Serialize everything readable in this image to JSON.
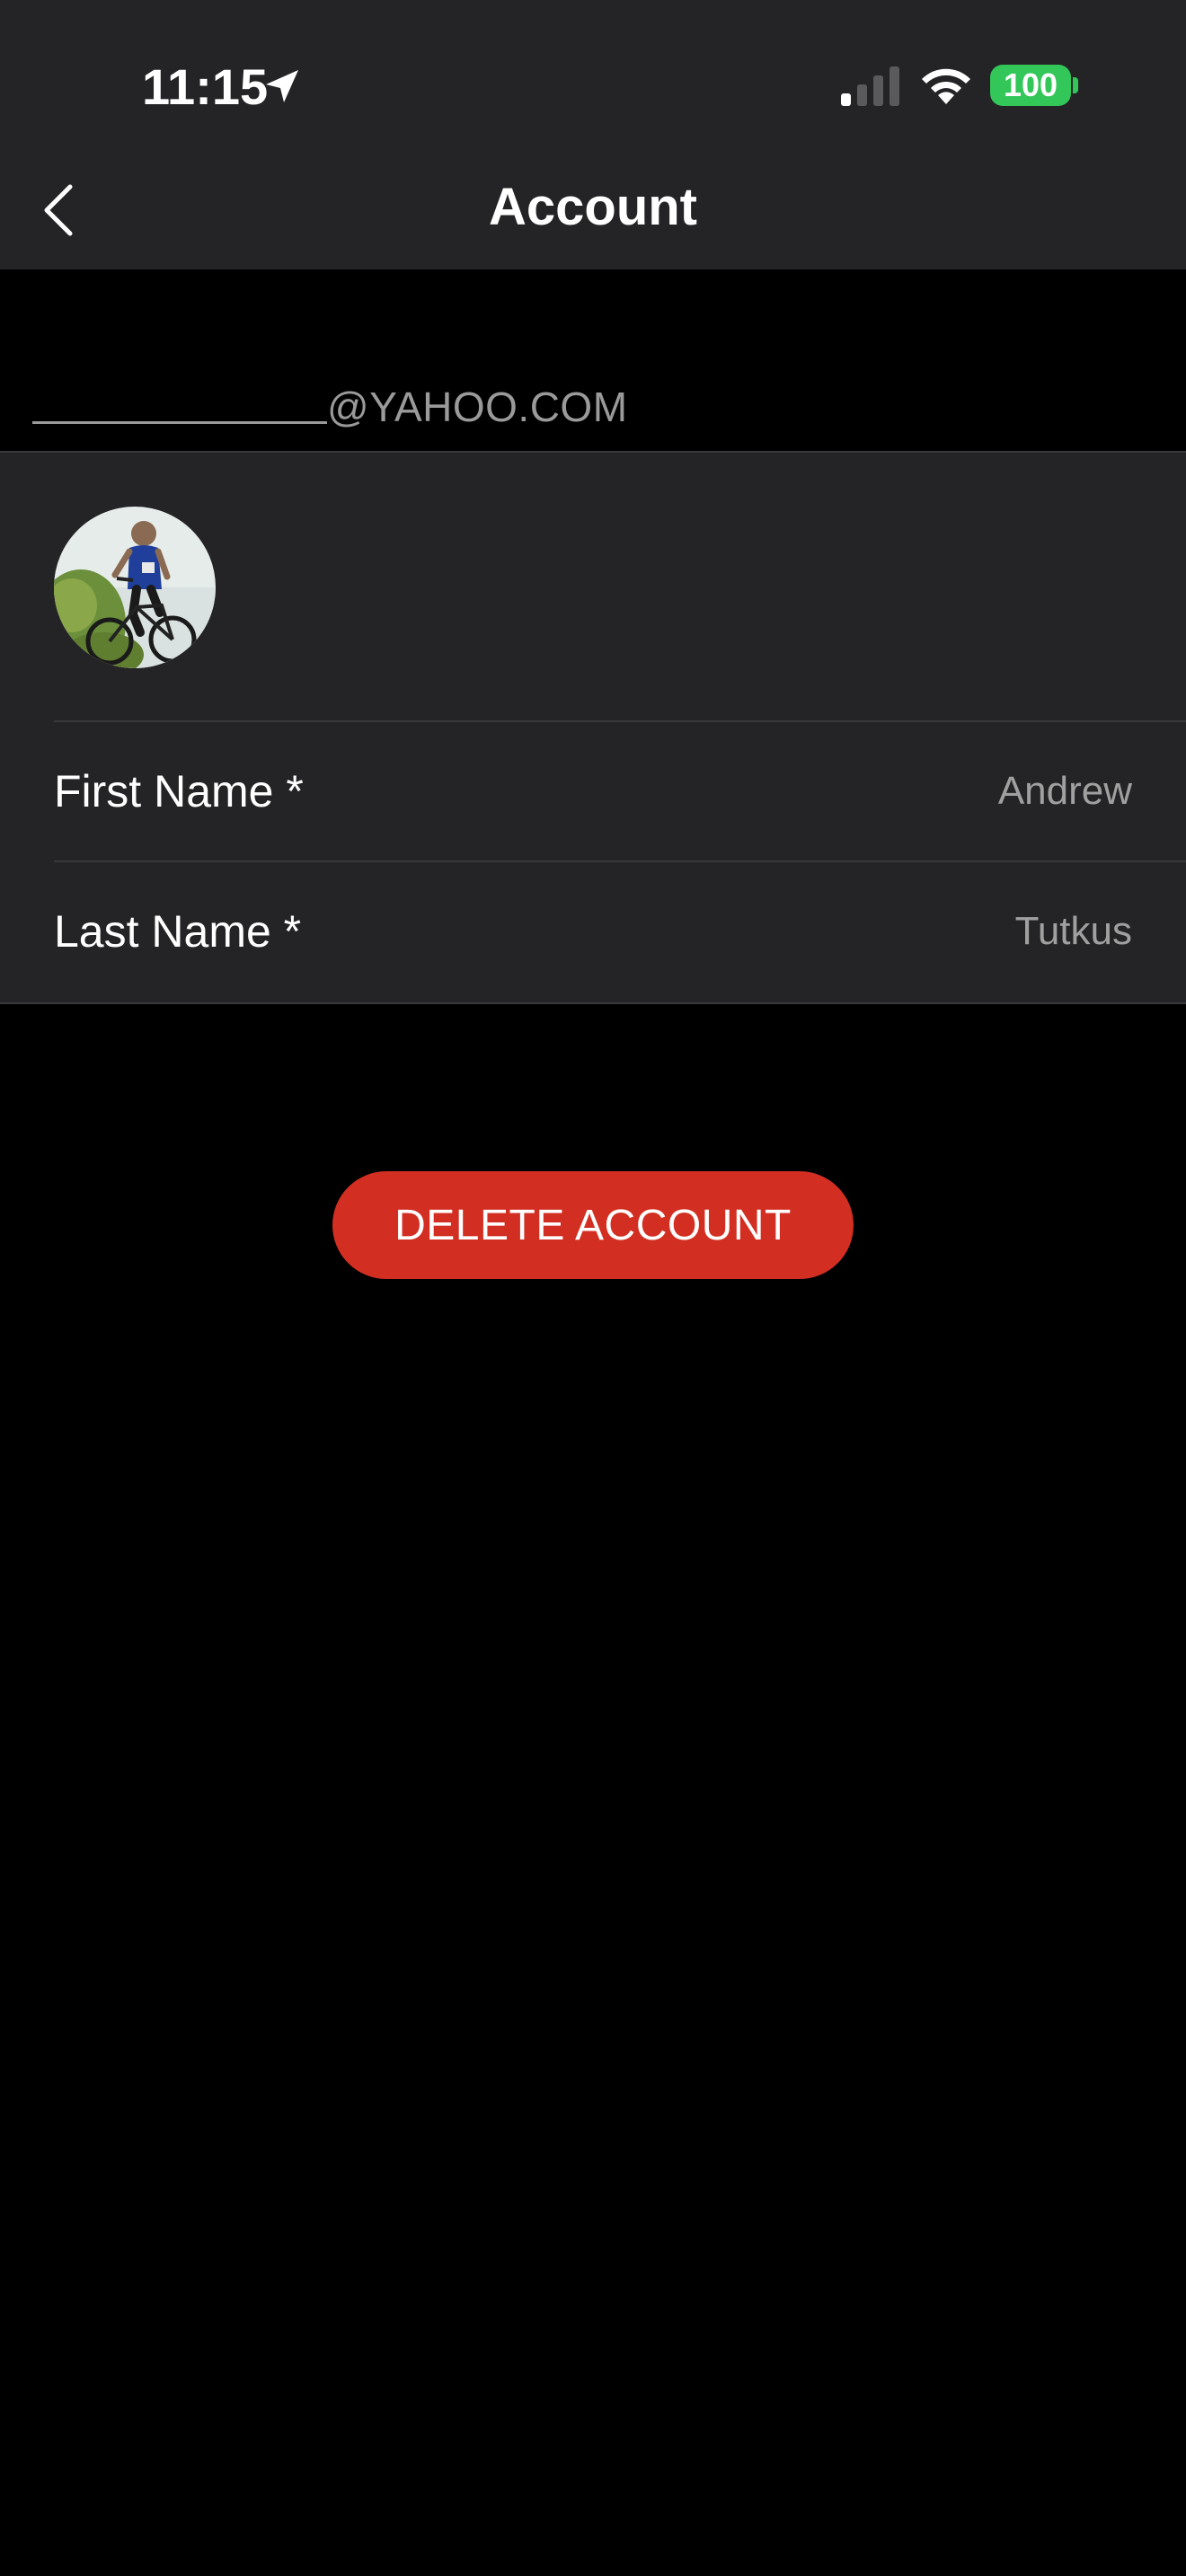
{
  "status_bar": {
    "time": "11:15",
    "battery_level": "100",
    "icons": [
      "location-arrow-icon",
      "cellular-signal-icon",
      "wifi-icon",
      "battery-icon"
    ],
    "battery_color": "#33c759"
  },
  "nav": {
    "title": "Account",
    "back_icon": "chevron-left-icon"
  },
  "email": {
    "domain": "@YAHOO.COM"
  },
  "profile": {
    "avatar": "profile-photo-cyclist",
    "fields": [
      {
        "label": "First Name *",
        "value": "Andrew"
      },
      {
        "label": "Last Name *",
        "value": "Tutkus"
      }
    ]
  },
  "actions": {
    "delete_label": "DELETE ACCOUNT",
    "delete_color": "#d22f22"
  },
  "colors": {
    "background": "#000000",
    "surface": "#242426",
    "secondary_text": "#a0a0a0"
  }
}
